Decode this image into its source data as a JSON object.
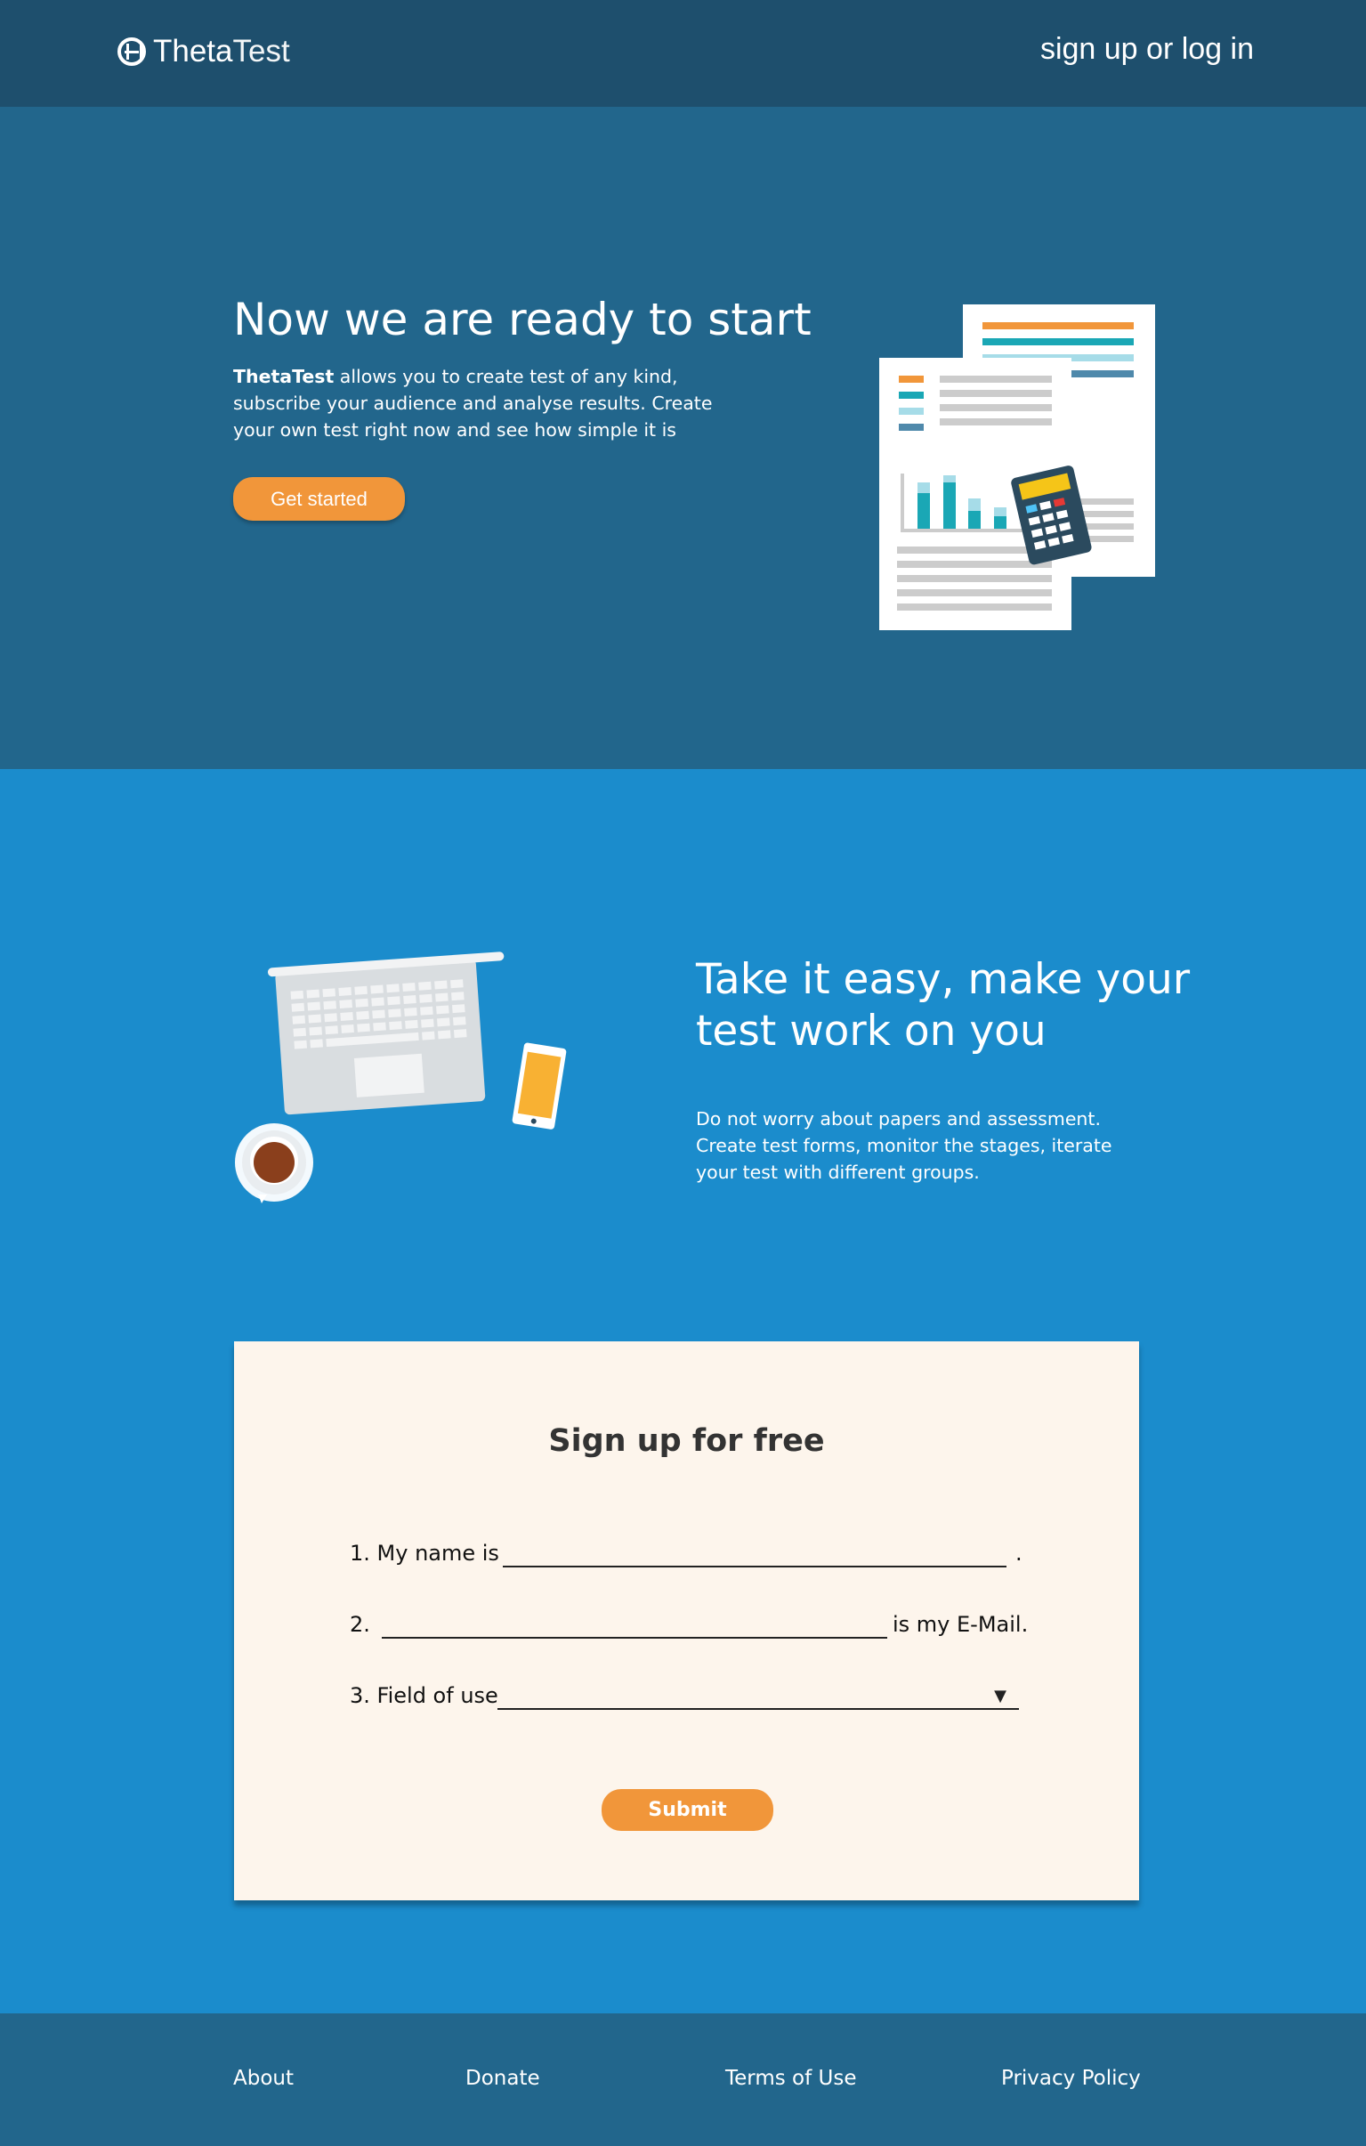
{
  "header": {
    "logo_bold": "Theta",
    "logo_light": "Test",
    "auth_link": "sign up or log in"
  },
  "hero": {
    "title": "Now we are ready to start",
    "text_bold": "ThetaTest",
    "text_rest": " allows you to create test of any kind, subscribe your audience and analyse results. Create your own test right now and see how simple it is",
    "cta_label": "Get started",
    "illustration_icon": "documents-calculator-icon"
  },
  "feature": {
    "title": "Take it easy, make your test work on you",
    "text": "Do not worry about papers and assessment. Create test forms, monitor the stages, iterate your test with different groups.",
    "illustration_icon": "laptop-phone-coffee-icon"
  },
  "signup_form": {
    "title": "Sign up for free",
    "row1_prefix": "1. My name is",
    "row1_suffix": ".",
    "row1_value": "",
    "row2_prefix": "2.",
    "row2_suffix": "is my E-Mail.",
    "row2_value": "",
    "row3_prefix": "3. Field of use",
    "row3_value": "",
    "select_arrow_icon": "▼",
    "submit_label": "Submit"
  },
  "footer": {
    "links": [
      "About",
      "Donate",
      "Terms of Use",
      "Privacy Policy"
    ]
  },
  "colors": {
    "header_bg": "#1e4f6d",
    "hero_bg": "#22668c",
    "feature_bg": "#1b8ccc",
    "accent_orange": "#f1963a",
    "card_bg": "#fdf5ec"
  }
}
